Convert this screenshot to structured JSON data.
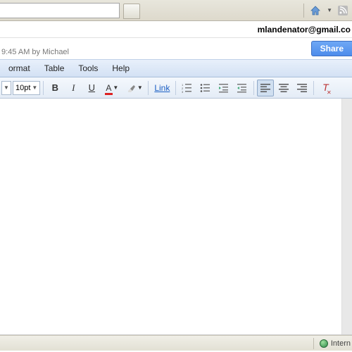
{
  "account": {
    "email": "mlandenator@gmail.co"
  },
  "meta": {
    "saved": "9:45 AM by Michael",
    "share_label": "Share"
  },
  "menu": {
    "format": "ormat",
    "table": "Table",
    "tools": "Tools",
    "help": "Help"
  },
  "toolbar": {
    "font_size": "10pt",
    "link_label": "Link"
  },
  "status": {
    "zone": "Intern"
  }
}
